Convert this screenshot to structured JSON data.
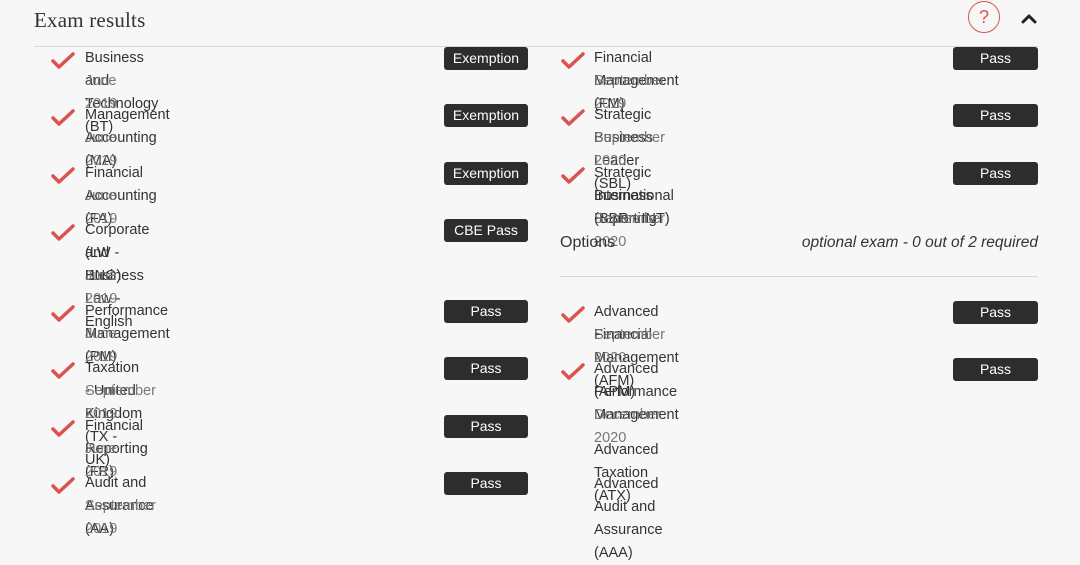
{
  "header": {
    "title": "Exam results",
    "help_icon": "?",
    "collapse_icon": "chevron-up-icon"
  },
  "colors": {
    "accent": "#d9534f",
    "badge_bg": "#2d2d2d"
  },
  "left_exams": [
    {
      "name": "Business and Technology (BT)",
      "date": "June 2019",
      "status": "Exemption"
    },
    {
      "name": "Management Accounting (MA)",
      "date": "June 2019",
      "status": "Exemption"
    },
    {
      "name": "Financial Accounting (FA)",
      "date": "June 2019",
      "status": "Exemption"
    },
    {
      "name": "Corporate and Business Law - English",
      "name2": "(LW - ENG)",
      "date": "June 2019",
      "status": "CBE Pass"
    },
    {
      "name": "Performance Management (PM)",
      "date": "June 2019",
      "status": "Pass"
    },
    {
      "name": "Taxation - United Kingdom (TX - UK)",
      "date": "September 2019",
      "status": "Pass"
    },
    {
      "name": "Financial Reporting (FR)",
      "date": "June 2019",
      "status": "Pass"
    },
    {
      "name": "Audit and Assurance (AA)",
      "date": "September 2019",
      "status": "Pass"
    }
  ],
  "right_exams": [
    {
      "name": "Financial Management (FM)",
      "date": "September 2019",
      "status": "Pass"
    },
    {
      "name": "Strategic Business Leader (SBL)",
      "date": "September 2020",
      "status": "Pass"
    },
    {
      "name": "Strategic Business Reporting -",
      "name2": "International (SBR - INT)",
      "date": "September 2020",
      "status": "Pass"
    }
  ],
  "options": {
    "label": "Options",
    "requirement": "optional exam - 0 out of 2 required",
    "exams": [
      {
        "name": "Advanced Financial Management (AFM)",
        "date": "September 2020",
        "status": "Pass"
      },
      {
        "name": "Advanced Performance Management",
        "name2": "(APM)",
        "date": "December 2020",
        "status": "Pass"
      },
      {
        "name": "Advanced Taxation (ATX)"
      },
      {
        "name": "Advanced Audit and Assurance (AAA)"
      }
    ]
  }
}
